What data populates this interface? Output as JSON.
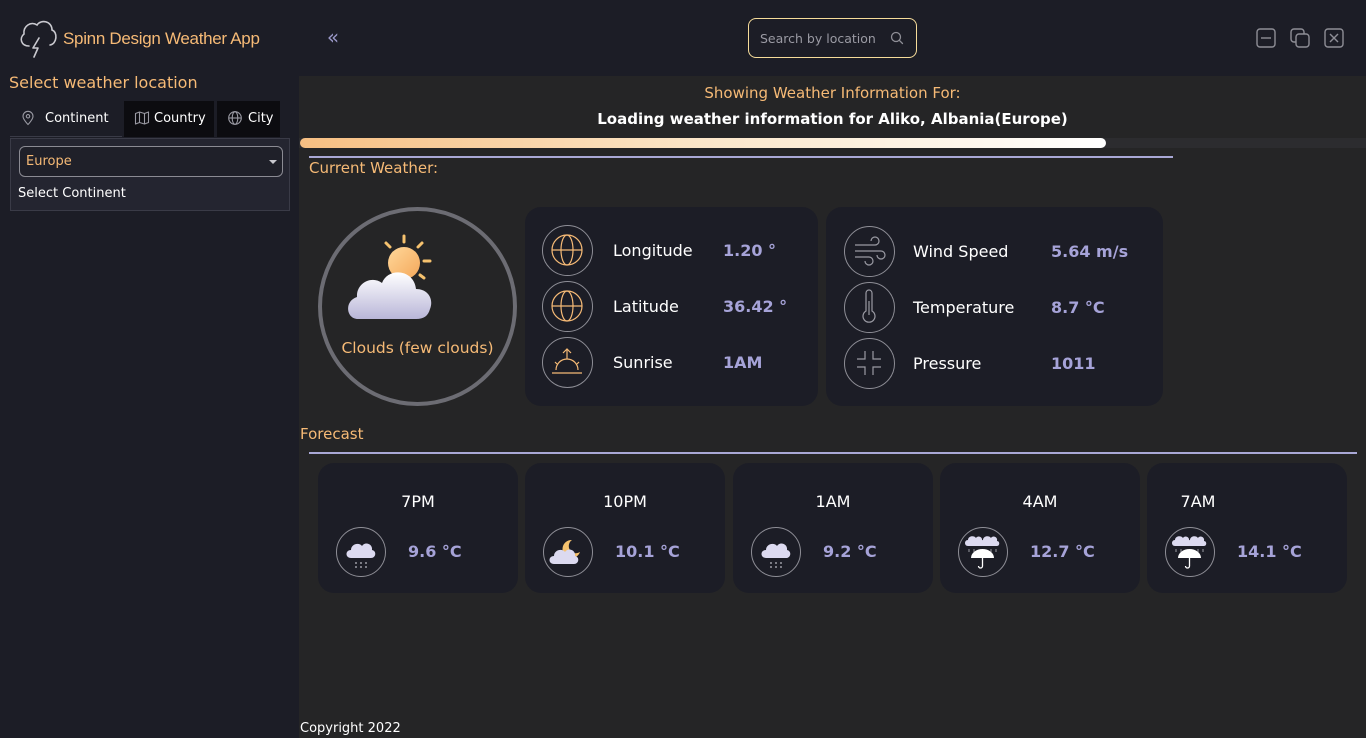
{
  "app": {
    "title": "Spinn Design Weather App"
  },
  "header": {
    "collapse_glyph": "«",
    "search": {
      "placeholder": "Search by location",
      "value": ""
    }
  },
  "sidebar": {
    "title": "Select weather location",
    "tabs": [
      {
        "label": "Continent",
        "icon": "map-pin-icon",
        "active": true
      },
      {
        "label": "Country",
        "icon": "map-icon",
        "active": false
      },
      {
        "label": "City",
        "icon": "globe-icon",
        "active": false
      }
    ],
    "continent_select": {
      "value": "Europe",
      "hint": "Select Continent"
    }
  },
  "main": {
    "showing_label": "Showing Weather Information For:",
    "loading_text": "Loading weather information for Aliko, Albania(Europe)",
    "progress": 0.755,
    "current_title": "Current Weather:",
    "condition": "Clouds (few clouds)",
    "stats_left": [
      {
        "label": "Longitude",
        "value": "1.20 °",
        "icon": "globe-icon"
      },
      {
        "label": "Latitude",
        "value": "36.42 °",
        "icon": "globe-icon"
      },
      {
        "label": "Sunrise",
        "value": "1AM",
        "icon": "sunrise-icon"
      }
    ],
    "stats_right": [
      {
        "label": "Wind Speed",
        "value": "5.64 m/s",
        "icon": "wind-icon"
      },
      {
        "label": "Temperature",
        "value": "8.7 °C",
        "icon": "thermometer-icon"
      },
      {
        "label": "Pressure",
        "value": "1011",
        "icon": "pressure-icon"
      }
    ],
    "forecast_title": "Forecast",
    "forecast": [
      {
        "time": "7PM",
        "temp": "9.6 °C",
        "icon": "snow-cloud-icon"
      },
      {
        "time": "10PM",
        "temp": "10.1 °C",
        "icon": "moon-cloud-icon"
      },
      {
        "time": "1AM",
        "temp": "9.2 °C",
        "icon": "snow-cloud-icon"
      },
      {
        "time": "4AM",
        "temp": "12.7 °C",
        "icon": "rain-umbrella-icon"
      },
      {
        "time": "7AM",
        "temp": "14.1 °C",
        "icon": "rain-umbrella-icon"
      }
    ],
    "copyright": "Copyright 2022"
  },
  "colors": {
    "accent": "#f6ba76",
    "value": "#a6a3d8",
    "background": "#1c1d26",
    "panel": "#252526"
  }
}
